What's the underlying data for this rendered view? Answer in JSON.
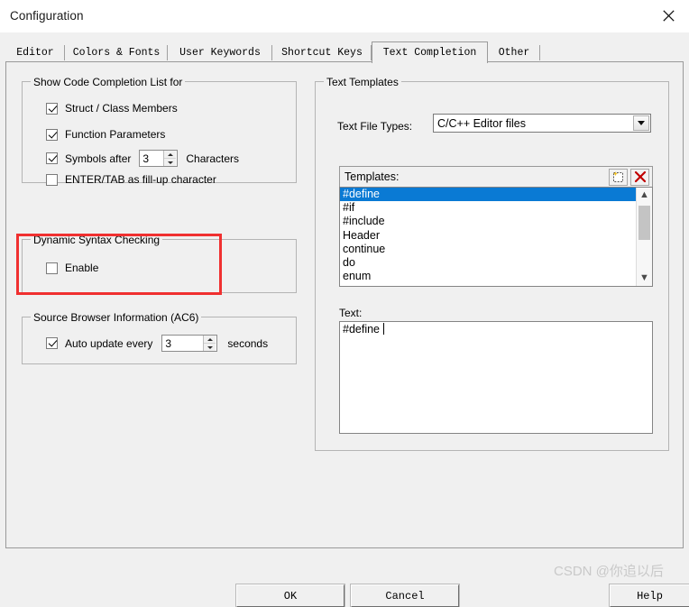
{
  "window": {
    "title": "Configuration",
    "close_icon": "close-icon"
  },
  "tabs": [
    {
      "label": "Editor",
      "selected": false
    },
    {
      "label": "Colors & Fonts",
      "selected": false
    },
    {
      "label": "User Keywords",
      "selected": false
    },
    {
      "label": "Shortcut Keys",
      "selected": false
    },
    {
      "label": "Text Completion",
      "selected": true
    },
    {
      "label": "Other",
      "selected": false
    }
  ],
  "left_panel": {
    "completion_group": {
      "title": "Show Code Completion List for",
      "options": [
        {
          "label": "Struct / Class Members",
          "checked": true
        },
        {
          "label": "Function Parameters",
          "checked": true
        },
        {
          "label": "Symbols after",
          "checked": true,
          "suffix": "Characters",
          "value": "3"
        },
        {
          "label": "ENTER/TAB as fill-up character",
          "checked": false
        }
      ]
    },
    "syntax_group": {
      "title": "Dynamic Syntax Checking",
      "options": [
        {
          "label": "Enable",
          "checked": false
        }
      ],
      "highlight_color": "#f03030"
    },
    "browser_group": {
      "title": "Source Browser Information (AC6)",
      "options": [
        {
          "label": "Auto update every",
          "checked": true,
          "value": "3",
          "suffix": "seconds"
        }
      ]
    }
  },
  "right_panel": {
    "group_title": "Text Templates",
    "file_types": {
      "label": "Text File Types:",
      "value": "C/C++ Editor files",
      "arrow_icon": "chevron-down-icon"
    },
    "templates": {
      "label": "Templates:",
      "new_icon": "new-template-icon",
      "delete_icon": "delete-x-icon",
      "items": [
        {
          "label": "#define",
          "selected": true
        },
        {
          "label": "#if",
          "selected": false
        },
        {
          "label": "#include",
          "selected": false
        },
        {
          "label": "Header",
          "selected": false
        },
        {
          "label": "continue",
          "selected": false
        },
        {
          "label": "do",
          "selected": false
        },
        {
          "label": "enum",
          "selected": false
        }
      ],
      "selection_color": "#0a7ad4",
      "scroll_up_icon": "chevron-up-icon",
      "scroll_down_icon": "chevron-down-icon"
    },
    "text_editor": {
      "label": "Text:",
      "value": "#define "
    }
  },
  "footer": {
    "ok_label": "OK",
    "cancel_label": "Cancel",
    "help_label": "Help"
  },
  "watermark": {
    "text": "CSDN @你追以后"
  }
}
